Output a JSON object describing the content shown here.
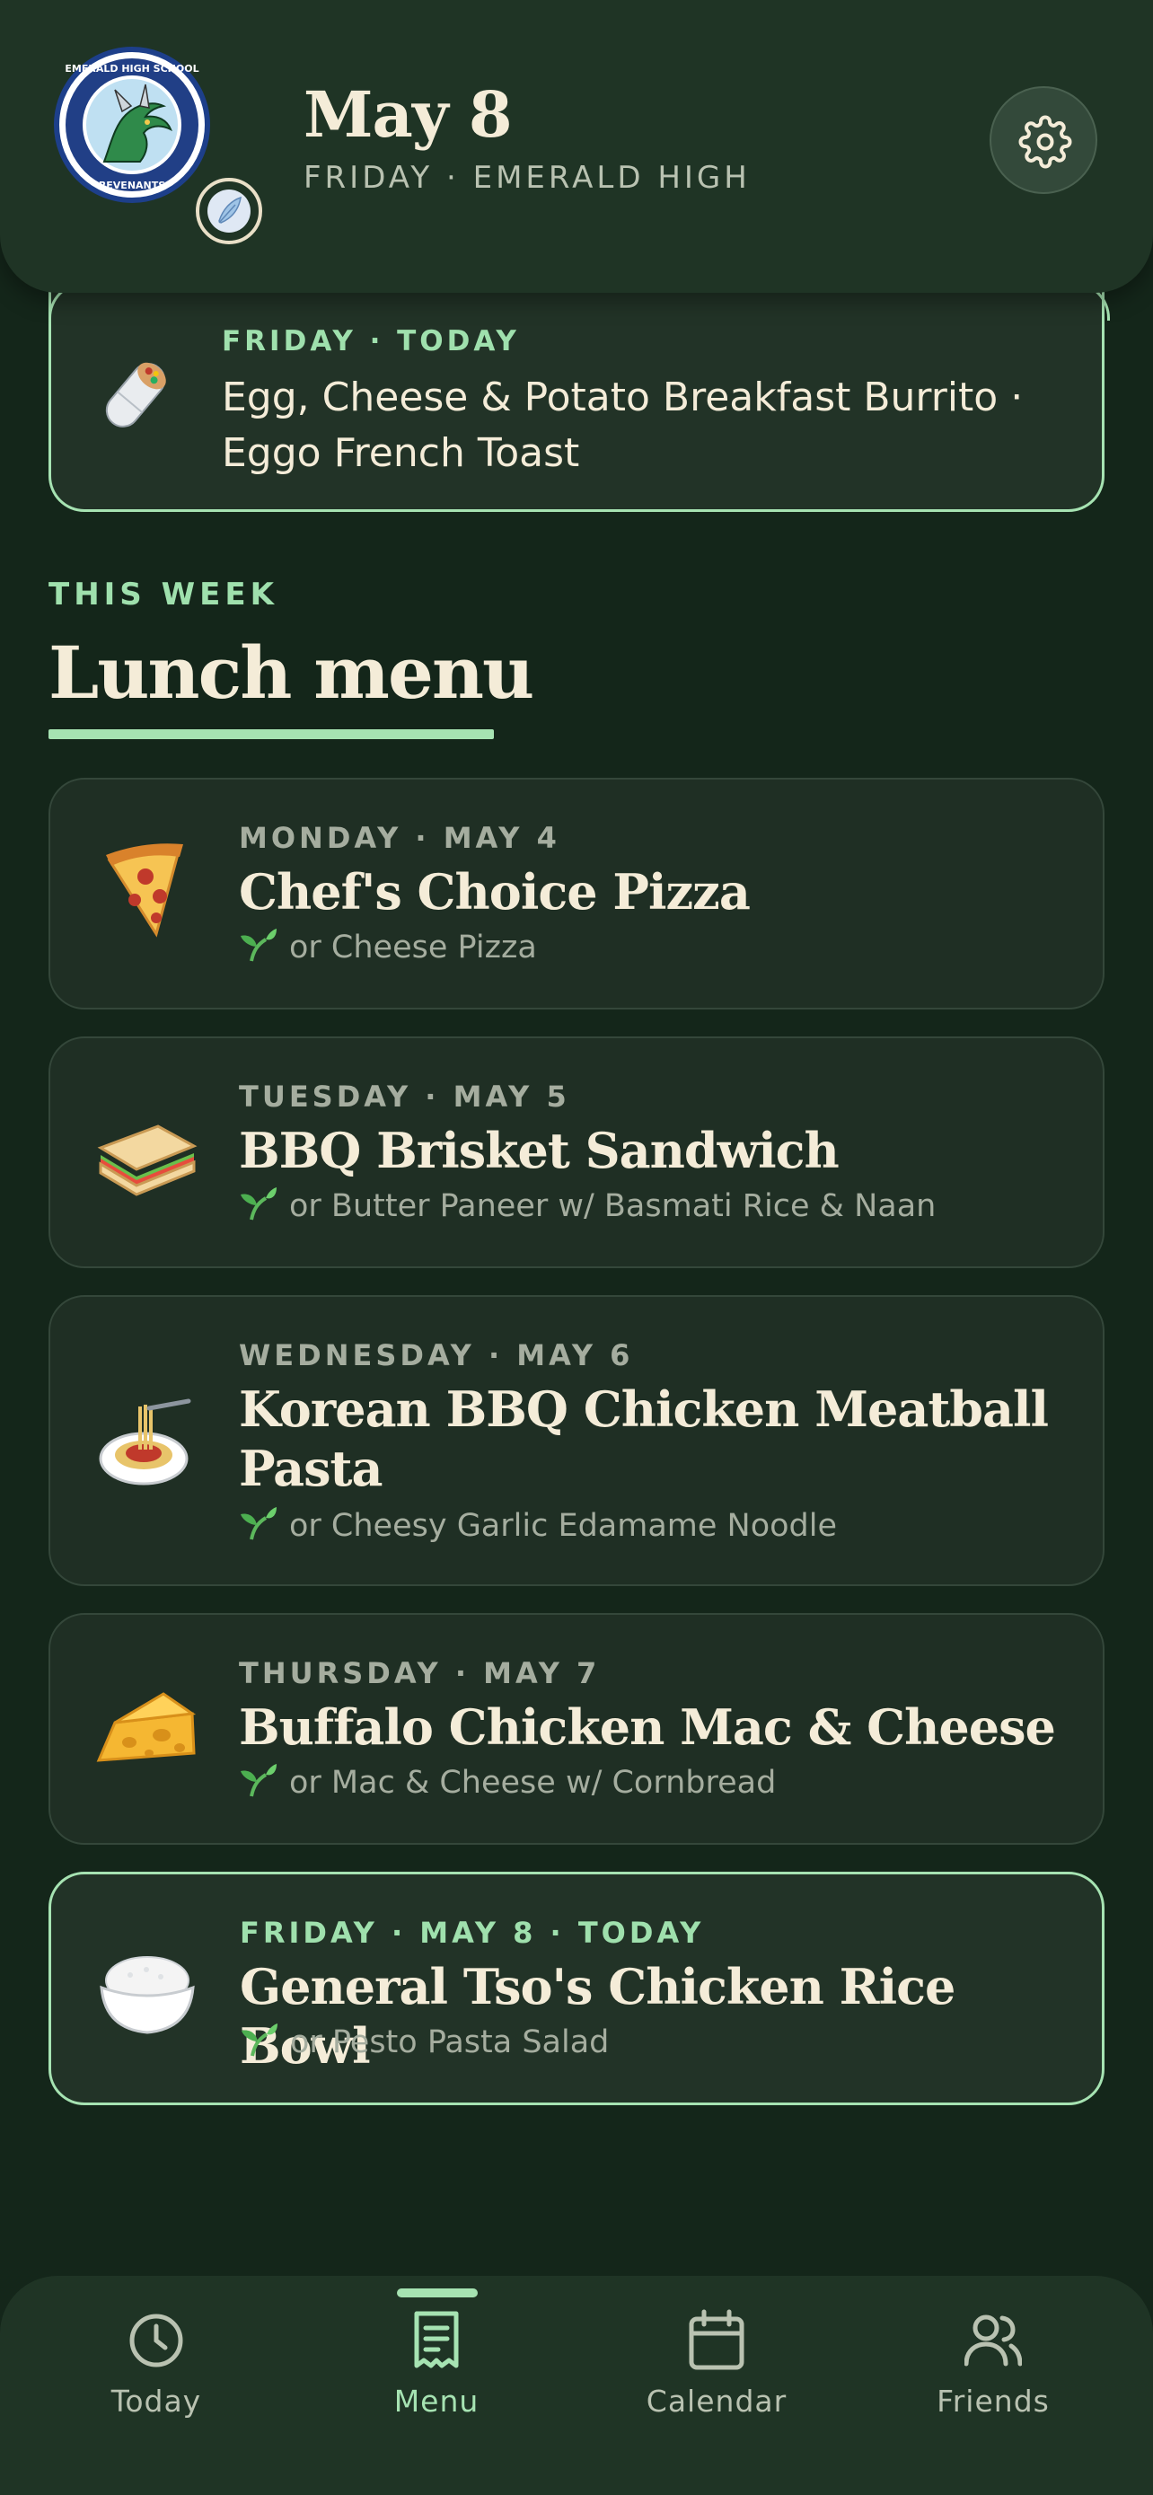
{
  "header": {
    "date": "May 8",
    "subtitle": "FRIDAY · EMERALD HIGH",
    "logo_icon": "school-crest-dragon",
    "logo_text": "EMERALD HIGH SCHOOL · HOME OF THE REVENANTS · 2023",
    "badge_icon": "feather-badge-icon",
    "settings_icon": "gear-icon"
  },
  "breakfast": {
    "label": "FRIDAY · TODAY",
    "text": "Egg, Cheese & Potato Breakfast Burrito · Eggo French Toast",
    "emoji": "burrito-icon"
  },
  "section": {
    "eyebrow": "THIS WEEK",
    "title": "Lunch menu"
  },
  "menu": [
    {
      "day": "MONDAY · MAY 4",
      "title": "Chef's Choice Pizza",
      "alt": "or Cheese Pizza",
      "emoji": "pizza-icon",
      "today": false
    },
    {
      "day": "TUESDAY · MAY 5",
      "title": "BBQ Brisket Sandwich",
      "alt": "or Butter Paneer w/ Basmati Rice & Naan",
      "emoji": "sandwich-icon",
      "today": false
    },
    {
      "day": "WEDNESDAY · MAY 6",
      "title": "Korean BBQ Chicken Meatball Pasta",
      "alt": "or Cheesy Garlic Edamame Noodle",
      "emoji": "spaghetti-icon",
      "today": false
    },
    {
      "day": "THURSDAY · MAY 7",
      "title": "Buffalo Chicken Mac & Cheese",
      "alt": "or Mac & Cheese w/ Cornbread",
      "emoji": "cheese-icon",
      "today": false
    },
    {
      "day": "FRIDAY · MAY 8 · TODAY",
      "title": "General Tso's Chicken Rice Bowl",
      "alt": "or Pesto Pasta Salad",
      "emoji": "rice-bowl-icon",
      "today": true
    }
  ],
  "nav": [
    {
      "label": "Today",
      "icon": "clock-icon",
      "active": false
    },
    {
      "label": "Menu",
      "icon": "receipt-icon",
      "active": true
    },
    {
      "label": "Calendar",
      "icon": "calendar-icon",
      "active": false
    },
    {
      "label": "Friends",
      "icon": "friends-icon",
      "active": false
    }
  ],
  "colors": {
    "background": "#14261a",
    "header": "#1f3425",
    "accent": "#a6e3b2",
    "cream": "#f4ecd8",
    "muted": "#a5ad9f"
  }
}
